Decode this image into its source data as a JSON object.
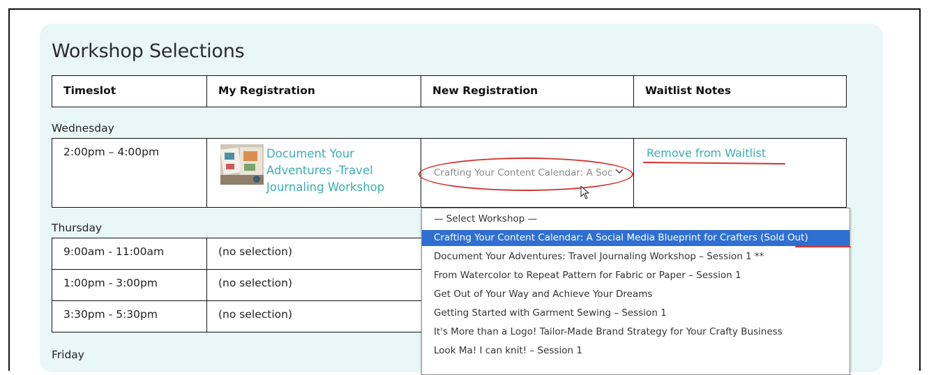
{
  "title": "Workshop Selections",
  "headers": [
    "Timeslot",
    "My Registration",
    "New Registration",
    "Waitlist Notes"
  ],
  "days": {
    "wednesday": "Wednesday",
    "thursday": "Thursday",
    "friday": "Friday"
  },
  "wednesday_row": {
    "time": "2:00pm – 4:00pm",
    "registration": "Document Your Adventures -Travel Journaling Workshop",
    "new_registration_select": "Crafting Your Content Calendar: A Soc",
    "waitlist_action": "Remove from Waitlist"
  },
  "thursday_rows": [
    {
      "time": "9:00am - 11:00am",
      "registration": "(no selection)"
    },
    {
      "time": "1:00pm - 3:00pm",
      "registration": "(no selection)"
    },
    {
      "time": "3:30pm - 5:30pm",
      "registration": "(no selection)"
    }
  ],
  "dropdown_options": [
    "— Select Workshop —",
    "Crafting Your Content Calendar: A Social Media Blueprint for Crafters (Sold Out)",
    "Document Your Adventures: Travel Journaling Workshop – Session 1 **",
    "From Watercolor to Repeat Pattern for Fabric or Paper – Session 1",
    "Get Out of Your Way and Achieve Your Dreams",
    "Getting Started with Garment Sewing – Session 1",
    "It's More than a Logo! Tailor-Made Brand Strategy for Your Crafty Business",
    "Look Ma! I can knit! – Session 1"
  ],
  "selected_option_index": 1,
  "colors": {
    "panel_bg": "#e9f7f6",
    "link": "#3aaeb1",
    "highlight": "#2f6fd1",
    "annotation": "#d1332e"
  },
  "icons": [
    "chevron-down-icon",
    "mouse-cursor-icon",
    "workshop-thumbnail"
  ]
}
